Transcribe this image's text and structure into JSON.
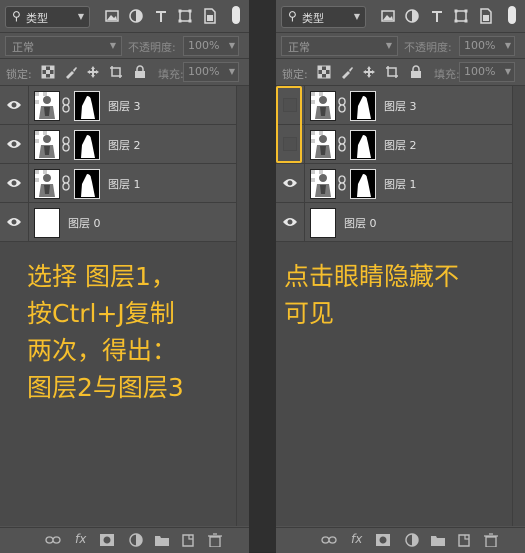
{
  "panels": [
    {
      "filter_label": "类型",
      "blend_mode": "正常",
      "opacity_label": "不透明度:",
      "opacity_value": "100%",
      "lock_label": "锁定:",
      "fill_label": "填充:",
      "fill_value": "100%",
      "layers": [
        {
          "name": "图层 3",
          "visible": true
        },
        {
          "name": "图层 2",
          "visible": true
        },
        {
          "name": "图层 1",
          "visible": true
        },
        {
          "name": "图层 0",
          "visible": true
        }
      ],
      "annotation": [
        "选择 图层1，",
        "按Ctrl+J复制",
        "两次，得出：",
        "图层2与图层3"
      ]
    },
    {
      "filter_label": "类型",
      "blend_mode": "正常",
      "opacity_label": "不透明度:",
      "opacity_value": "100%",
      "lock_label": "锁定:",
      "fill_label": "填充:",
      "fill_value": "100%",
      "layers": [
        {
          "name": "图层 3",
          "visible": false
        },
        {
          "name": "图层 2",
          "visible": false
        },
        {
          "name": "图层 1",
          "visible": true
        },
        {
          "name": "图层 0",
          "visible": true
        }
      ],
      "annotation": [
        "点击眼睛隐藏不",
        "可见"
      ]
    }
  ],
  "icons": {
    "filter": [
      "image-filter-icon",
      "adjustment-filter-icon",
      "type-filter-icon",
      "shape-filter-icon",
      "smart-object-filter-icon"
    ],
    "lock": [
      "lock-transparent-pixels-icon",
      "lock-image-pixels-icon",
      "lock-position-icon",
      "lock-artboard-icon",
      "lock-all-icon"
    ],
    "bottom": [
      "link-layers-icon",
      "fx-icon",
      "add-mask-icon",
      "adjustment-layer-icon",
      "group-icon",
      "new-layer-icon",
      "delete-icon"
    ]
  },
  "fx_text": "fx",
  "colors": {
    "accent": "#f6bf2d",
    "panel": "#535353",
    "text": "#e0e0e0"
  }
}
